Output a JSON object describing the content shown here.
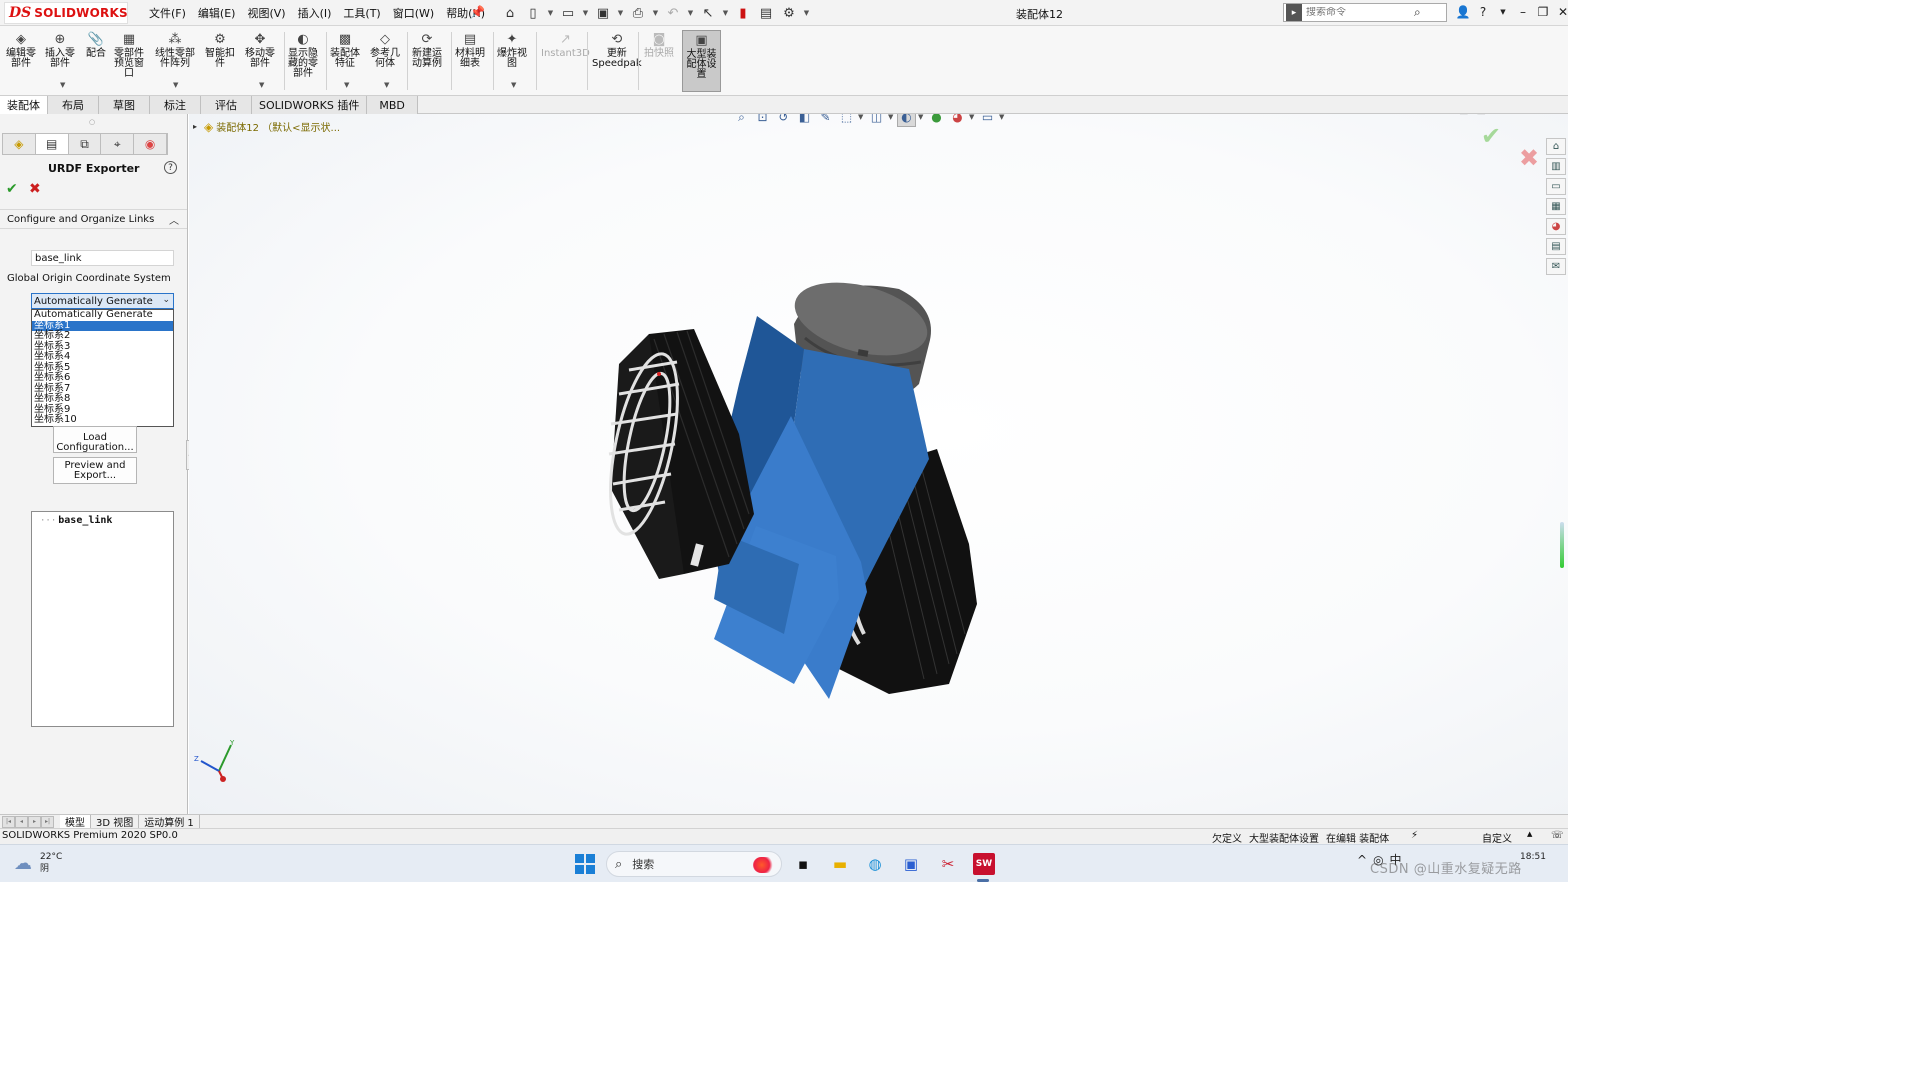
{
  "titlebar": {
    "logo_ds": "DS",
    "logo_text": "SOLIDWORKS",
    "menus": [
      "文件(F)",
      "编辑(E)",
      "视图(V)",
      "插入(I)",
      "工具(T)",
      "窗口(W)",
      "帮助(H)"
    ],
    "doc_title": "装配体12",
    "search_placeholder": "搜索命令"
  },
  "command_manager": {
    "tools": [
      {
        "label": "编辑零\n部件",
        "icon": "edit-component-icon"
      },
      {
        "label": "插入零\n部件",
        "icon": "insert-component-icon"
      },
      {
        "label": "配合",
        "icon": "mate-icon"
      },
      {
        "label": "零部件\n预览窗\n口",
        "icon": "component-preview-icon"
      },
      {
        "label": "线性零部\n件阵列",
        "icon": "linear-pattern-icon"
      },
      {
        "label": "智能扣\n件",
        "icon": "smart-fastener-icon"
      },
      {
        "label": "移动零\n部件",
        "icon": "move-component-icon"
      },
      {
        "label": "显示隐\n藏的零\n部件",
        "icon": "show-hidden-icon"
      },
      {
        "label": "装配体\n特征",
        "icon": "assembly-feature-icon"
      },
      {
        "label": "参考几\n何体",
        "icon": "reference-geometry-icon"
      },
      {
        "label": "新建运\n动算例",
        "icon": "motion-study-icon"
      },
      {
        "label": "材料明\n细表",
        "icon": "bom-icon"
      },
      {
        "label": "爆炸视\n图",
        "icon": "exploded-view-icon"
      },
      {
        "label": "Instant3D",
        "icon": "instant3d-icon",
        "disabled": true
      },
      {
        "label": "更新\nSpeedpak",
        "icon": "speedpak-icon"
      },
      {
        "label": "拍快照",
        "icon": "snapshot-icon",
        "disabled": true
      },
      {
        "label": "大型装\n配体设\n置",
        "icon": "large-assembly-icon",
        "active": true
      }
    ]
  },
  "tabs": [
    "装配体",
    "布局",
    "草图",
    "标注",
    "评估",
    "SOLIDWORKS 插件",
    "MBD"
  ],
  "active_tab": "装配体",
  "property_manager": {
    "title": "URDF Exporter",
    "help": "?",
    "ok": "✔",
    "cancel": "✖",
    "group_header": "Configure and Organize Links",
    "link_name_value": "base_link",
    "coord_label": "Global Origin Coordinate System",
    "combo_value": "Automatically Generate",
    "dropdown_options": [
      "Automatically Generate",
      "坐标系1",
      "坐标系2",
      "坐标系3",
      "坐标系4",
      "坐标系5",
      "坐标系6",
      "坐标系7",
      "坐标系8",
      "坐标系9",
      "坐标系10"
    ],
    "dropdown_selected": "坐标系1",
    "load_button": "Load\nConfiguration...",
    "preview_button": "Preview and\nExport...",
    "tree_root": "base_link"
  },
  "graphics": {
    "feature_tree_root": "装配体12 （默认<显示状...",
    "triad": {
      "y": "Y",
      "z": "Z"
    },
    "colors": {
      "body": "#3a78c4",
      "wheel": "#151515",
      "cap": "#5a5a5a",
      "rim": "#dcdcdc"
    }
  },
  "bottom_tabs": [
    "模型",
    "3D 视图",
    "运动算例 1"
  ],
  "status": {
    "product": "SOLIDWORKS Premium 2020 SP0.0",
    "underdefined": "欠定义",
    "large_asm": "大型装配体设置",
    "editing": "在编辑 装配体",
    "custom": "自定义"
  },
  "taskbar": {
    "temp": "22°C",
    "weather": "阴",
    "search": "搜索",
    "time": "18:51",
    "watermark": "CSDN @山重水复疑无路"
  }
}
